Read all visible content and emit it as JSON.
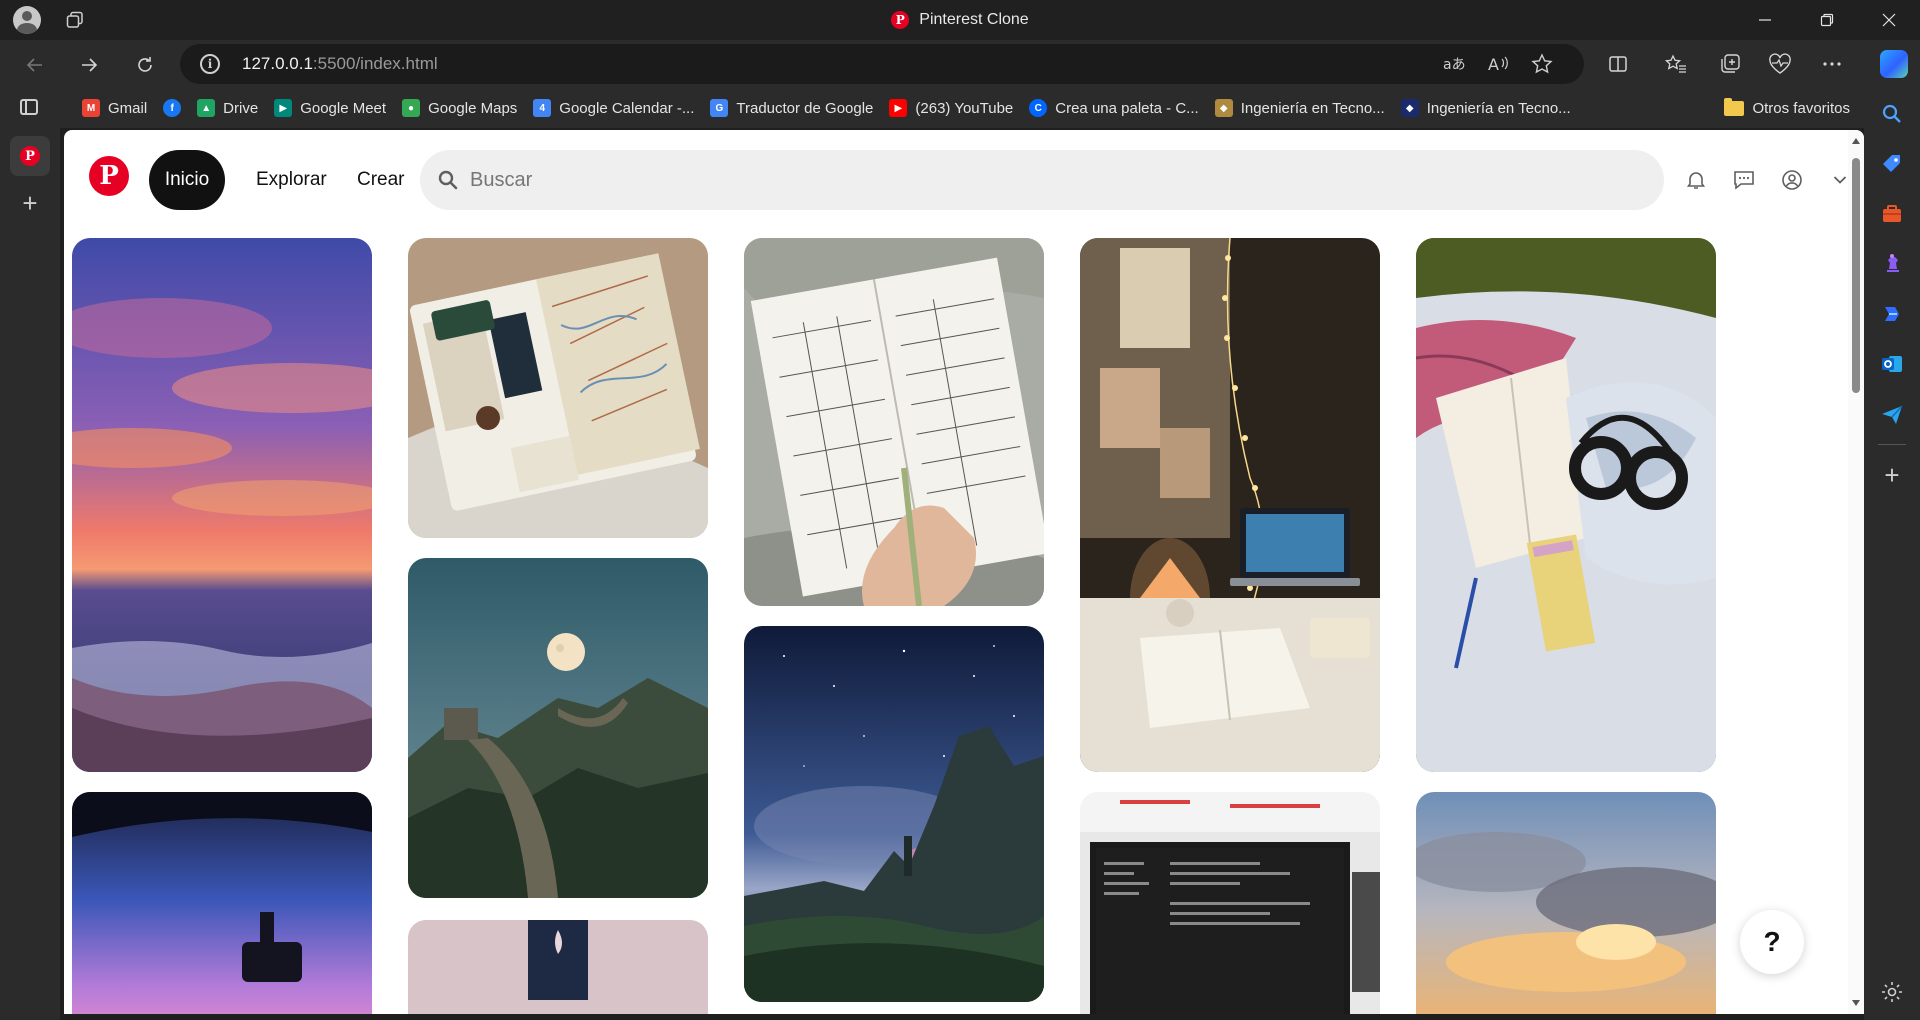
{
  "browser": {
    "window_title": "Pinterest Clone",
    "url_host": "127.0.0.1",
    "url_rest": ":5500/index.html",
    "favorites": [
      {
        "label": "Gmail",
        "icon": "gmail-icon",
        "color": "#ea4335"
      },
      {
        "label": "",
        "icon": "facebook-icon",
        "color": "#1877f2"
      },
      {
        "label": "Drive",
        "icon": "drive-icon",
        "color": "#1fa463"
      },
      {
        "label": "Google Meet",
        "icon": "meet-icon",
        "color": "#00897b"
      },
      {
        "label": "Google Maps",
        "icon": "maps-icon",
        "color": "#34a853"
      },
      {
        "label": "Google Calendar -...",
        "icon": "calendar-icon",
        "color": "#4285f4"
      },
      {
        "label": "Traductor de Google",
        "icon": "translate-icon",
        "color": "#4285f4"
      },
      {
        "label": "(263) YouTube",
        "icon": "youtube-icon",
        "color": "#ff0000"
      },
      {
        "label": "Crea una paleta - C...",
        "icon": "coolors-icon",
        "color": "#0066ff"
      },
      {
        "label": "Ingeniería en Tecno...",
        "icon": "university-icon",
        "color": "#b08a3e"
      },
      {
        "label": "Ingeniería en Tecno...",
        "icon": "university-icon",
        "color": "#1a2a6c"
      }
    ],
    "other_favorites": "Otros favoritos"
  },
  "page": {
    "logo_letter": "P",
    "nav": {
      "home": "Inicio",
      "explore": "Explorar",
      "create": "Crear"
    },
    "search_placeholder": "Buscar",
    "help_label": "?"
  },
  "pins": [
    {
      "id": "sunset-sea",
      "description": "Purple and orange sunset over ocean waves"
    },
    {
      "id": "travel-journal",
      "description": "Open travel journal with map and tickets"
    },
    {
      "id": "calendar-notebook",
      "description": "Hand writing in February planner notebook"
    },
    {
      "id": "cozy-desk",
      "description": "Desk with laptop, lamp and fairy lights"
    },
    {
      "id": "picnic-book",
      "description": "Open book and headphones on blanket in grass"
    },
    {
      "id": "car-sunset",
      "description": "Sunset seen from car windshield"
    },
    {
      "id": "great-wall-moon",
      "description": "Great Wall at dusk with full moon"
    },
    {
      "id": "night-mountains",
      "description": "Starry night over rocky peaks and lake"
    },
    {
      "id": "code-monitor",
      "description": "Monitor showing code in office"
    },
    {
      "id": "cloud-sunset",
      "description": "Golden sunset clouds"
    },
    {
      "id": "pink-room",
      "description": "Pink wall with framed picture"
    }
  ]
}
